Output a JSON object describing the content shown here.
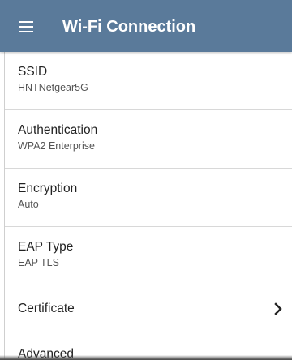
{
  "toolbar": {
    "title": "Wi-Fi Connection",
    "menu_icon": "hamburger-menu-icon",
    "background_color": "#5a7a9a"
  },
  "settings": {
    "ssid": {
      "label": "SSID",
      "value": "HNTNetgear5G"
    },
    "authentication": {
      "label": "Authentication",
      "value": "WPA2 Enterprise"
    },
    "encryption": {
      "label": "Encryption",
      "value": "Auto"
    },
    "eap_type": {
      "label": "EAP Type",
      "value": "EAP TLS"
    },
    "certificate": {
      "label": "Certificate",
      "icon": "chevron-right-icon"
    },
    "advanced": {
      "label": "Advanced"
    }
  }
}
